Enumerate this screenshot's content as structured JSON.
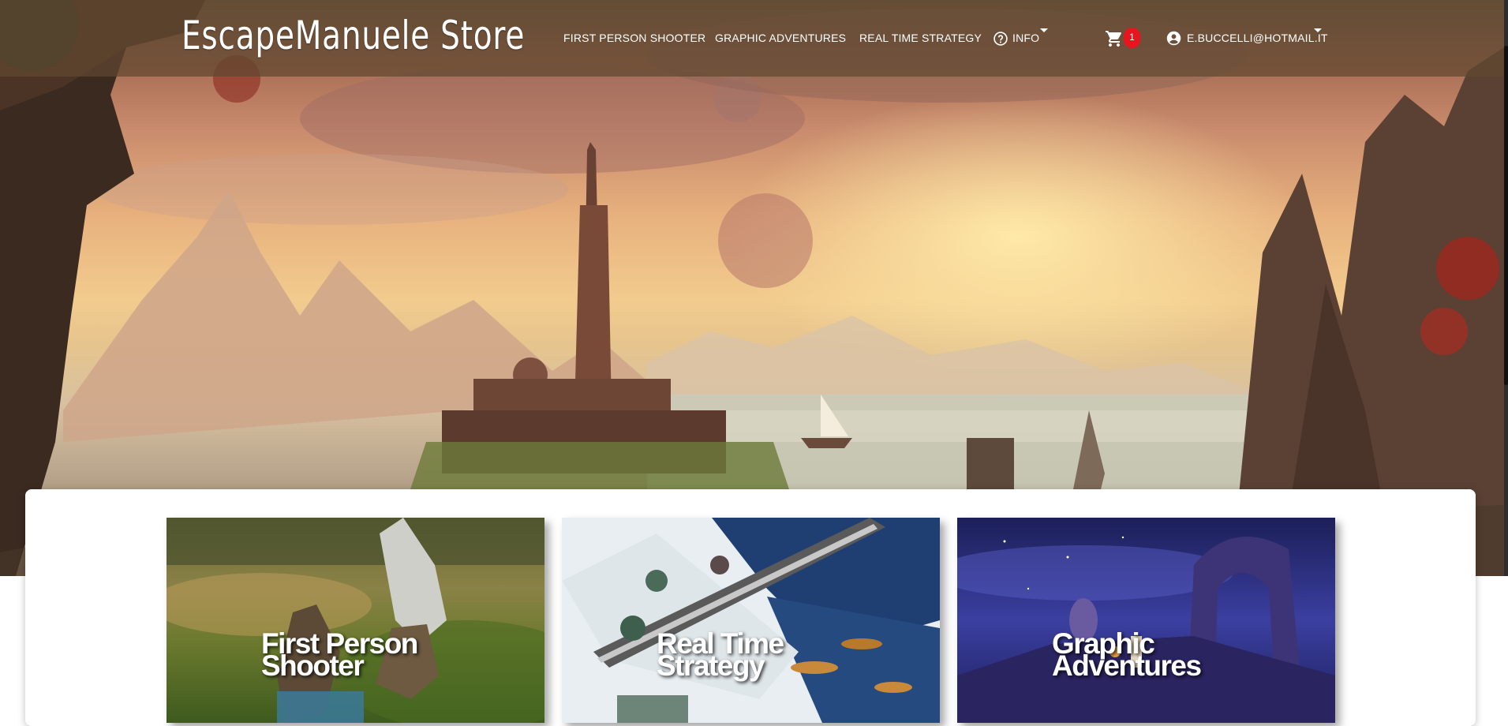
{
  "brand": {
    "name": "EscapeManuele Store"
  },
  "nav": {
    "fps": "FIRST PERSON SHOOTER",
    "adventures": "GRAPHIC ADVENTURES",
    "rts": "REAL TIME STRATEGY",
    "info": "INFO",
    "cart_count": "1",
    "account": "E.BUCCELLI@HOTMAIL.IT"
  },
  "icons": {
    "info": "help-circle-icon",
    "cart": "shopping-cart-icon",
    "account": "account-circle-icon"
  },
  "categories": [
    {
      "line1": "First Person",
      "line2": "Shooter"
    },
    {
      "line1": "Real Time",
      "line2": "Strategy"
    },
    {
      "line1": "Graphic",
      "line2": "Adventures"
    }
  ],
  "colors": {
    "navbar": "#5f4830",
    "badge": "#e8141e",
    "panel": "#ffffff"
  }
}
